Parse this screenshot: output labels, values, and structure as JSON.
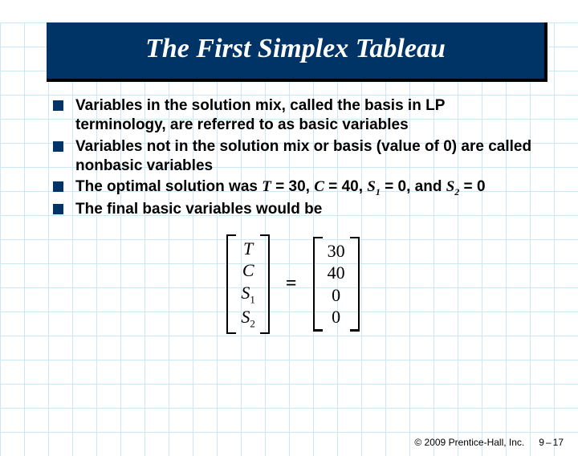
{
  "title": "The First Simplex Tableau",
  "bullets": [
    {
      "pre": "Variables in the solution mix, called the ",
      "kw1": "basis",
      "mid1": " in LP terminology, are referred to as ",
      "kw2": "basic variables",
      "post": ""
    },
    {
      "pre": "Variables not in the solution mix or basis (value of 0) are called ",
      "kw1": "nonbasic variables",
      "mid1": "",
      "kw2": "",
      "post": ""
    },
    {
      "pre": "The optimal solution was ",
      "kw1": "",
      "mid1": "",
      "kw2": "",
      "post": "",
      "eqline": true
    },
    {
      "pre": "The final basic variables would be",
      "kw1": "",
      "mid1": "",
      "kw2": "",
      "post": ""
    }
  ],
  "solution": {
    "T_label": "T",
    "T_val": "30",
    "C_label": "C",
    "C_val": "40",
    "S1_label": "S",
    "S1_sub": "1",
    "S1_val": "0",
    "S2_label": "S",
    "S2_sub": "2",
    "S2_val": "0",
    "and": "and"
  },
  "vector": {
    "vars": [
      "T",
      "C",
      "S1",
      "S2"
    ],
    "vals": [
      "30",
      "40",
      "0",
      "0"
    ],
    "equals": "="
  },
  "footer": {
    "copyright": "© 2009 Prentice-Hall, Inc.",
    "chapter": "9",
    "sep": "–",
    "page": "17"
  }
}
